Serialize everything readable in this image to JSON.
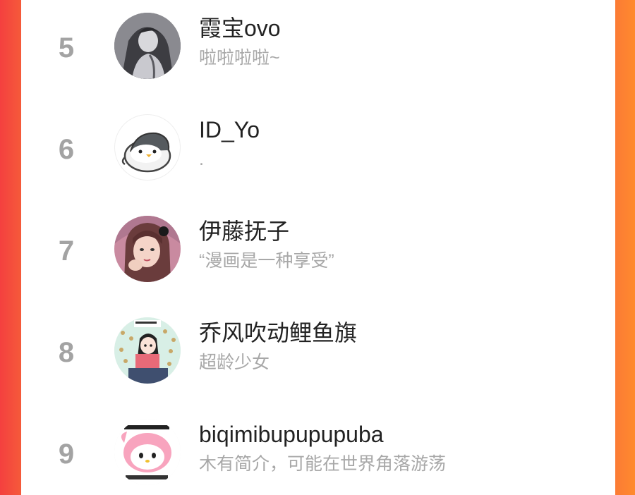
{
  "users": [
    {
      "rank": "5",
      "name": "霞宝ovo",
      "bio": "啦啦啦啦~",
      "avatar_icon": "avatar-illustration-couple-icon"
    },
    {
      "rank": "6",
      "name": "ID_Yo",
      "bio": ".",
      "avatar_icon": "avatar-penguin-icon"
    },
    {
      "rank": "7",
      "name": "伊藤抚子",
      "bio": "“漫画是一种享受”",
      "avatar_icon": "avatar-girl-photo-icon"
    },
    {
      "rank": "8",
      "name": "乔风吹动鲤鱼旗",
      "bio": "超龄少女",
      "avatar_icon": "avatar-comic-girl-icon"
    },
    {
      "rank": "9",
      "name": "biqimibupupupuba",
      "bio": "木有简介，可能在世界角落游荡",
      "avatar_icon": "avatar-pink-rabbit-icon"
    }
  ],
  "colors": {
    "rank_text": "#a3a3a3",
    "name_text": "#222222",
    "bio_text": "#a8a8a8",
    "background_left": "#f4403f",
    "background_right": "#ff8a2e"
  }
}
